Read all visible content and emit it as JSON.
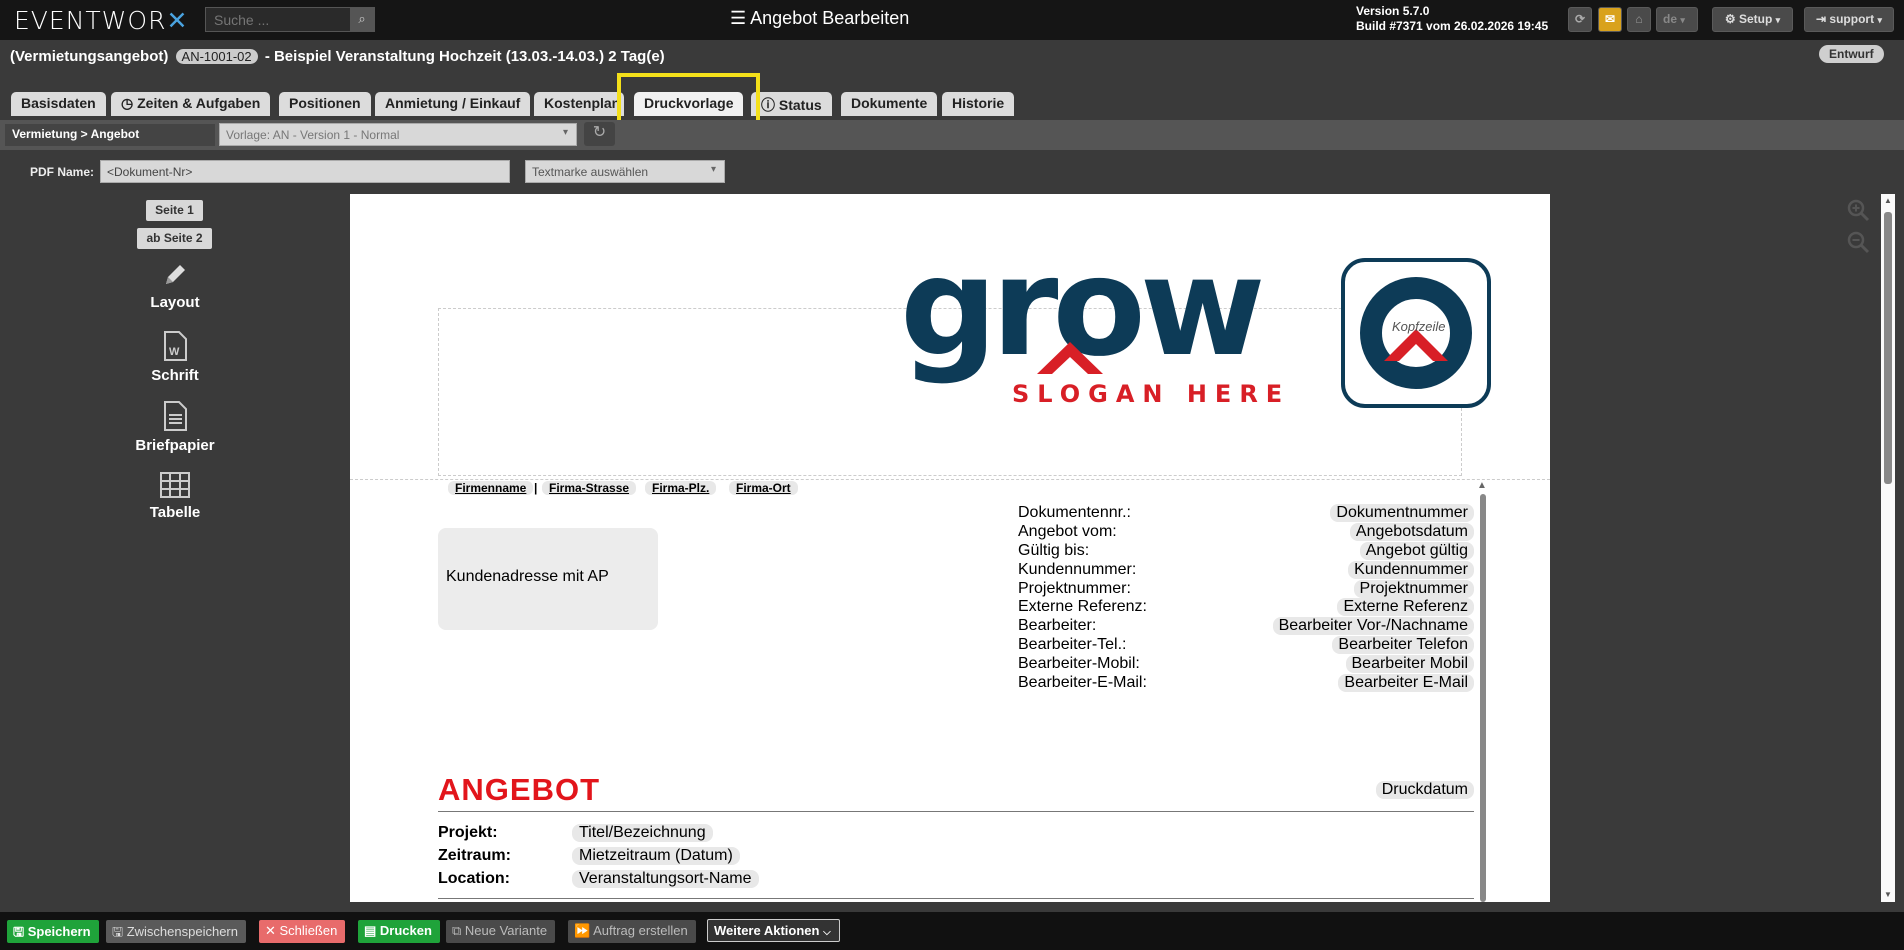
{
  "topbar": {
    "logo_text": "EVENTWOR",
    "logo_x": "✕",
    "search_placeholder": "Suche ...",
    "title": "Angebot Bearbeiten",
    "version_line1": "Version 5.7.0",
    "version_line2": "Build #7371 vom 26.02.2026 19:45",
    "lang": "de",
    "setup_label": "Setup",
    "user_label": "support"
  },
  "header": {
    "type": "(Vermietungsangebot)",
    "doc_number": "AN-1001-02",
    "event": "- Beispiel Veranstaltung Hochzeit (13.03.-14.03.) 2 Tag(e)",
    "status": "Entwurf"
  },
  "tabs": [
    "Basisdaten",
    "Zeiten & Aufgaben",
    "Positionen",
    "Anmietung / Einkauf",
    "Kostenplan",
    "Druckvorlage",
    "Status",
    "Dokumente",
    "Historie"
  ],
  "subbar": {
    "breadcrumb": "Vermietung > Angebot",
    "template_value": "Vorlage: AN - Version 1 - Normal"
  },
  "pdf": {
    "label": "PDF Name:",
    "value": "<Dokument-Nr>",
    "textmarke_placeholder": "Textmarke auswählen"
  },
  "sidebar": {
    "page1": "Seite 1",
    "page2": "ab Seite 2",
    "items": [
      "Layout",
      "Schrift",
      "Briefpapier",
      "Tabelle"
    ]
  },
  "document": {
    "logo_word": "grow",
    "logo_slogan": "SLOGAN HERE",
    "header_zone_label": "Kopfzeile",
    "sender": [
      "Firmenname",
      "Firma-Strasse",
      "Firma-Plz.",
      "Firma-Ort"
    ],
    "sender_sep": "|",
    "customer_address": "Kundenadresse mit AP",
    "info_labels": [
      "Dokumentennr.:",
      "Angebot vom:",
      "Gültig bis:",
      "Kundennummer:",
      "Projektnummer:",
      "Externe Referenz:",
      "Bearbeiter:",
      "Bearbeiter-Tel.:",
      "Bearbeiter-Mobil:",
      "Bearbeiter-E-Mail:"
    ],
    "info_values": [
      "Dokumentnummer",
      "Angebotsdatum",
      "Angebot gültig",
      "Kundennummer",
      "Projektnummer",
      "Externe Referenz",
      "Bearbeiter Vor-/Nachname",
      "Bearbeiter Telefon",
      "Bearbeiter Mobil",
      "Bearbeiter E-Mail"
    ],
    "heading": "ANGEBOT",
    "print_date": "Druckdatum",
    "project_label": "Projekt:",
    "project_value": "Titel/Bezeichnung",
    "period_label": "Zeitraum:",
    "period_value": "Mietzeitraum (Datum)",
    "location_label": "Location:",
    "location_value": "Veranstaltungsort-Name"
  },
  "footer": {
    "save": "Speichern",
    "intermediate": "Zwischenspeichern",
    "close": "Schließen",
    "print": "Drucken",
    "new_variant": "Neue Variante",
    "create_order": "Auftrag erstellen",
    "more": "Weitere Aktionen"
  },
  "colors": {
    "accent_yellow": "#f4e01a",
    "save_green": "#1fa33a",
    "close_red": "#e86b6b",
    "logo_blue": "#0d3b57",
    "logo_red": "#d81f26"
  }
}
